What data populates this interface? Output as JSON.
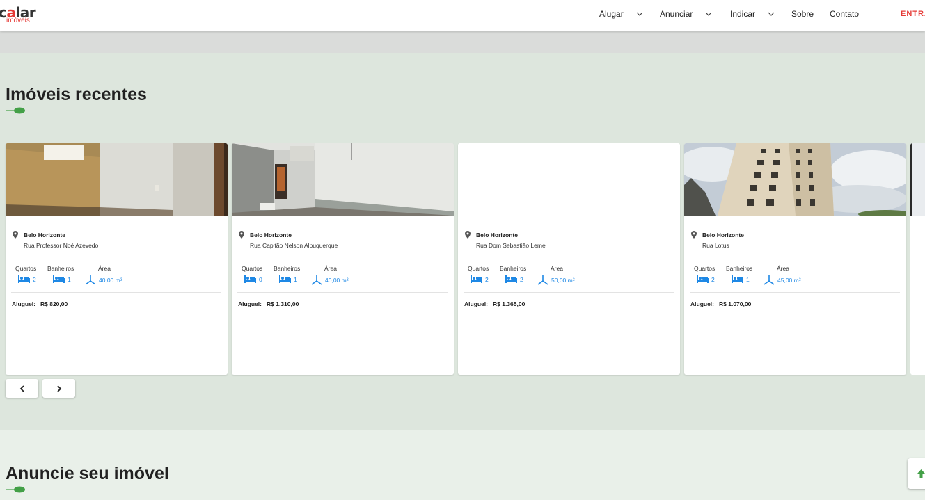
{
  "header": {
    "logo_word_a": "c",
    "logo_word_b": "a",
    "logo_word_c": "lar",
    "logo_sub": "imóveis",
    "nav": [
      {
        "label": "Alugar",
        "has_dropdown": true
      },
      {
        "label": "Anunciar",
        "has_dropdown": true
      },
      {
        "label": "Indicar",
        "has_dropdown": true
      },
      {
        "label": "Sobre",
        "has_dropdown": false
      },
      {
        "label": "Contato",
        "has_dropdown": false
      }
    ],
    "enter_label": "ENTRAR"
  },
  "recent": {
    "title": "Imóveis recentes",
    "feature_labels": {
      "bedrooms": "Quartos",
      "bathrooms": "Banheiros",
      "area": "Área"
    },
    "price_label": "Aluguel:",
    "cards": [
      {
        "city": "Belo Horizonte",
        "street": "Rua Professor Noé Azevedo",
        "bedrooms": "2",
        "bathrooms": "1",
        "area": "40,00 m²",
        "price": "R$ 820,00",
        "photo": "empty-room-yellow-walls"
      },
      {
        "city": "Belo Horizonte",
        "street": "Rua Capitão Nelson Albuquerque",
        "bedrooms": "0",
        "bathrooms": "1",
        "area": "40,00 m²",
        "price": "R$ 1.310,00",
        "photo": "empty-room-white-walls"
      },
      {
        "city": "Belo Horizonte",
        "street": "Rua Dom Sebastião Leme",
        "bedrooms": "2",
        "bathrooms": "2",
        "area": "50,00 m²",
        "price": "R$ 1.365,00",
        "photo": "none"
      },
      {
        "city": "Belo Horizonte",
        "street": "Rua Lotus",
        "bedrooms": "2",
        "bathrooms": "1",
        "area": "45,00 m²",
        "price": "R$ 1.070,00",
        "photo": "building-facade-sky"
      }
    ],
    "prev_icon": "chevron-left-icon",
    "next_icon": "chevron-right-icon"
  },
  "advertise": {
    "title": "Anuncie seu imóvel"
  },
  "fab_icon": "arrow-up-icon",
  "colors": {
    "brand_red": "#e53935",
    "accent_green": "#43a047",
    "feature_blue": "#1e88e5",
    "section_bg": "#dde6dd"
  }
}
